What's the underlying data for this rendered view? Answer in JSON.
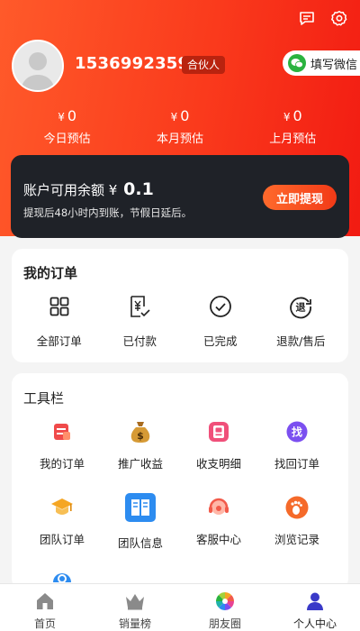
{
  "header": {
    "icons": [
      "message-icon",
      "settings-icon"
    ],
    "phone": "15369923590",
    "badge": "合伙人",
    "wechat_button": "填写微信"
  },
  "stats": [
    {
      "currency": "¥",
      "value": "0",
      "label": "今日预估"
    },
    {
      "currency": "¥",
      "value": "0",
      "label": "本月预估"
    },
    {
      "currency": "¥",
      "value": "0",
      "label": "上月预估"
    }
  ],
  "balance": {
    "label": "账户可用余额",
    "currency": "¥",
    "amount": "0.1",
    "note": "提现后48小时内到账，节假日延后。",
    "withdraw_button": "立即提现"
  },
  "orders": {
    "title": "我的订单",
    "items": [
      {
        "label": "全部订单",
        "icon": "grid-icon"
      },
      {
        "label": "已付款",
        "icon": "paid-receipt-icon"
      },
      {
        "label": "已完成",
        "icon": "check-circle-icon"
      },
      {
        "label": "退款/售后",
        "icon": "refund-icon"
      }
    ]
  },
  "tools": {
    "title": "工具栏",
    "items": [
      {
        "label": "我的订单",
        "icon": "order-list-icon",
        "color": "#f04a4a"
      },
      {
        "label": "推广收益",
        "icon": "money-bag-icon",
        "color": "#c98a2a"
      },
      {
        "label": "收支明细",
        "icon": "ledger-icon",
        "color": "#f0507a"
      },
      {
        "label": "找回订单",
        "icon": "find-order-icon",
        "color": "#7b4ff0"
      },
      {
        "label": "团队订单",
        "icon": "graduation-cap-icon",
        "color": "#f5a623"
      },
      {
        "label": "团队信息",
        "icon": "book-icon",
        "color": "#2d8cf0"
      },
      {
        "label": "客服中心",
        "icon": "headset-icon",
        "color": "#f25a4a"
      },
      {
        "label": "浏览记录",
        "icon": "footprint-icon",
        "color": "#f56a2a"
      }
    ]
  },
  "tabbar": [
    {
      "label": "首页",
      "icon": "home-icon"
    },
    {
      "label": "销量榜",
      "icon": "crown-icon"
    },
    {
      "label": "朋友圈",
      "icon": "pinwheel-icon"
    },
    {
      "label": "个人中心",
      "icon": "person-icon",
      "active": true
    }
  ],
  "colors": {
    "header_start": "#ff5a2a",
    "header_end": "#f21b12",
    "balance_bg": "#1f2228",
    "accent": "#f23a17",
    "tab_active": "#3a3ac8"
  }
}
